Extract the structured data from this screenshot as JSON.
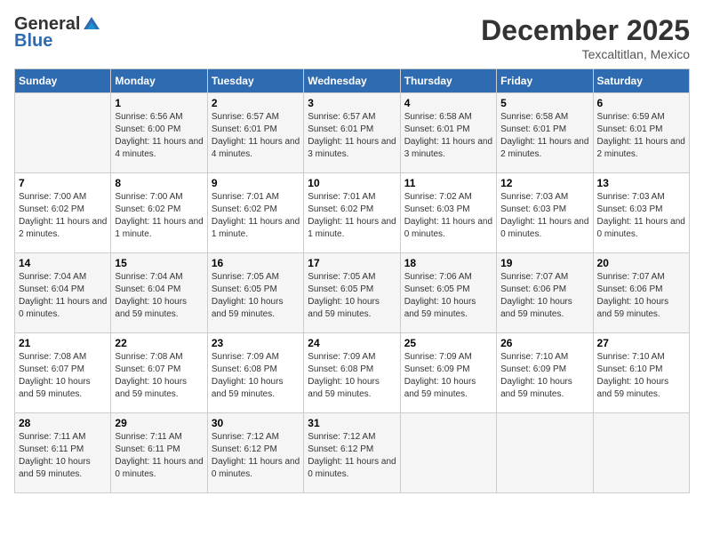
{
  "header": {
    "logo_line1": "General",
    "logo_line2": "Blue",
    "month": "December 2025",
    "location": "Texcaltitlan, Mexico"
  },
  "weekdays": [
    "Sunday",
    "Monday",
    "Tuesday",
    "Wednesday",
    "Thursday",
    "Friday",
    "Saturday"
  ],
  "weeks": [
    [
      {
        "day": "",
        "sunrise": "",
        "sunset": "",
        "daylight": ""
      },
      {
        "day": "1",
        "sunrise": "Sunrise: 6:56 AM",
        "sunset": "Sunset: 6:00 PM",
        "daylight": "Daylight: 11 hours and 4 minutes."
      },
      {
        "day": "2",
        "sunrise": "Sunrise: 6:57 AM",
        "sunset": "Sunset: 6:01 PM",
        "daylight": "Daylight: 11 hours and 4 minutes."
      },
      {
        "day": "3",
        "sunrise": "Sunrise: 6:57 AM",
        "sunset": "Sunset: 6:01 PM",
        "daylight": "Daylight: 11 hours and 3 minutes."
      },
      {
        "day": "4",
        "sunrise": "Sunrise: 6:58 AM",
        "sunset": "Sunset: 6:01 PM",
        "daylight": "Daylight: 11 hours and 3 minutes."
      },
      {
        "day": "5",
        "sunrise": "Sunrise: 6:58 AM",
        "sunset": "Sunset: 6:01 PM",
        "daylight": "Daylight: 11 hours and 2 minutes."
      },
      {
        "day": "6",
        "sunrise": "Sunrise: 6:59 AM",
        "sunset": "Sunset: 6:01 PM",
        "daylight": "Daylight: 11 hours and 2 minutes."
      }
    ],
    [
      {
        "day": "7",
        "sunrise": "Sunrise: 7:00 AM",
        "sunset": "Sunset: 6:02 PM",
        "daylight": "Daylight: 11 hours and 2 minutes."
      },
      {
        "day": "8",
        "sunrise": "Sunrise: 7:00 AM",
        "sunset": "Sunset: 6:02 PM",
        "daylight": "Daylight: 11 hours and 1 minute."
      },
      {
        "day": "9",
        "sunrise": "Sunrise: 7:01 AM",
        "sunset": "Sunset: 6:02 PM",
        "daylight": "Daylight: 11 hours and 1 minute."
      },
      {
        "day": "10",
        "sunrise": "Sunrise: 7:01 AM",
        "sunset": "Sunset: 6:02 PM",
        "daylight": "Daylight: 11 hours and 1 minute."
      },
      {
        "day": "11",
        "sunrise": "Sunrise: 7:02 AM",
        "sunset": "Sunset: 6:03 PM",
        "daylight": "Daylight: 11 hours and 0 minutes."
      },
      {
        "day": "12",
        "sunrise": "Sunrise: 7:03 AM",
        "sunset": "Sunset: 6:03 PM",
        "daylight": "Daylight: 11 hours and 0 minutes."
      },
      {
        "day": "13",
        "sunrise": "Sunrise: 7:03 AM",
        "sunset": "Sunset: 6:03 PM",
        "daylight": "Daylight: 11 hours and 0 minutes."
      }
    ],
    [
      {
        "day": "14",
        "sunrise": "Sunrise: 7:04 AM",
        "sunset": "Sunset: 6:04 PM",
        "daylight": "Daylight: 11 hours and 0 minutes."
      },
      {
        "day": "15",
        "sunrise": "Sunrise: 7:04 AM",
        "sunset": "Sunset: 6:04 PM",
        "daylight": "Daylight: 10 hours and 59 minutes."
      },
      {
        "day": "16",
        "sunrise": "Sunrise: 7:05 AM",
        "sunset": "Sunset: 6:05 PM",
        "daylight": "Daylight: 10 hours and 59 minutes."
      },
      {
        "day": "17",
        "sunrise": "Sunrise: 7:05 AM",
        "sunset": "Sunset: 6:05 PM",
        "daylight": "Daylight: 10 hours and 59 minutes."
      },
      {
        "day": "18",
        "sunrise": "Sunrise: 7:06 AM",
        "sunset": "Sunset: 6:05 PM",
        "daylight": "Daylight: 10 hours and 59 minutes."
      },
      {
        "day": "19",
        "sunrise": "Sunrise: 7:07 AM",
        "sunset": "Sunset: 6:06 PM",
        "daylight": "Daylight: 10 hours and 59 minutes."
      },
      {
        "day": "20",
        "sunrise": "Sunrise: 7:07 AM",
        "sunset": "Sunset: 6:06 PM",
        "daylight": "Daylight: 10 hours and 59 minutes."
      }
    ],
    [
      {
        "day": "21",
        "sunrise": "Sunrise: 7:08 AM",
        "sunset": "Sunset: 6:07 PM",
        "daylight": "Daylight: 10 hours and 59 minutes."
      },
      {
        "day": "22",
        "sunrise": "Sunrise: 7:08 AM",
        "sunset": "Sunset: 6:07 PM",
        "daylight": "Daylight: 10 hours and 59 minutes."
      },
      {
        "day": "23",
        "sunrise": "Sunrise: 7:09 AM",
        "sunset": "Sunset: 6:08 PM",
        "daylight": "Daylight: 10 hours and 59 minutes."
      },
      {
        "day": "24",
        "sunrise": "Sunrise: 7:09 AM",
        "sunset": "Sunset: 6:08 PM",
        "daylight": "Daylight: 10 hours and 59 minutes."
      },
      {
        "day": "25",
        "sunrise": "Sunrise: 7:09 AM",
        "sunset": "Sunset: 6:09 PM",
        "daylight": "Daylight: 10 hours and 59 minutes."
      },
      {
        "day": "26",
        "sunrise": "Sunrise: 7:10 AM",
        "sunset": "Sunset: 6:09 PM",
        "daylight": "Daylight: 10 hours and 59 minutes."
      },
      {
        "day": "27",
        "sunrise": "Sunrise: 7:10 AM",
        "sunset": "Sunset: 6:10 PM",
        "daylight": "Daylight: 10 hours and 59 minutes."
      }
    ],
    [
      {
        "day": "28",
        "sunrise": "Sunrise: 7:11 AM",
        "sunset": "Sunset: 6:11 PM",
        "daylight": "Daylight: 10 hours and 59 minutes."
      },
      {
        "day": "29",
        "sunrise": "Sunrise: 7:11 AM",
        "sunset": "Sunset: 6:11 PM",
        "daylight": "Daylight: 11 hours and 0 minutes."
      },
      {
        "day": "30",
        "sunrise": "Sunrise: 7:12 AM",
        "sunset": "Sunset: 6:12 PM",
        "daylight": "Daylight: 11 hours and 0 minutes."
      },
      {
        "day": "31",
        "sunrise": "Sunrise: 7:12 AM",
        "sunset": "Sunset: 6:12 PM",
        "daylight": "Daylight: 11 hours and 0 minutes."
      },
      {
        "day": "",
        "sunrise": "",
        "sunset": "",
        "daylight": ""
      },
      {
        "day": "",
        "sunrise": "",
        "sunset": "",
        "daylight": ""
      },
      {
        "day": "",
        "sunrise": "",
        "sunset": "",
        "daylight": ""
      }
    ]
  ]
}
